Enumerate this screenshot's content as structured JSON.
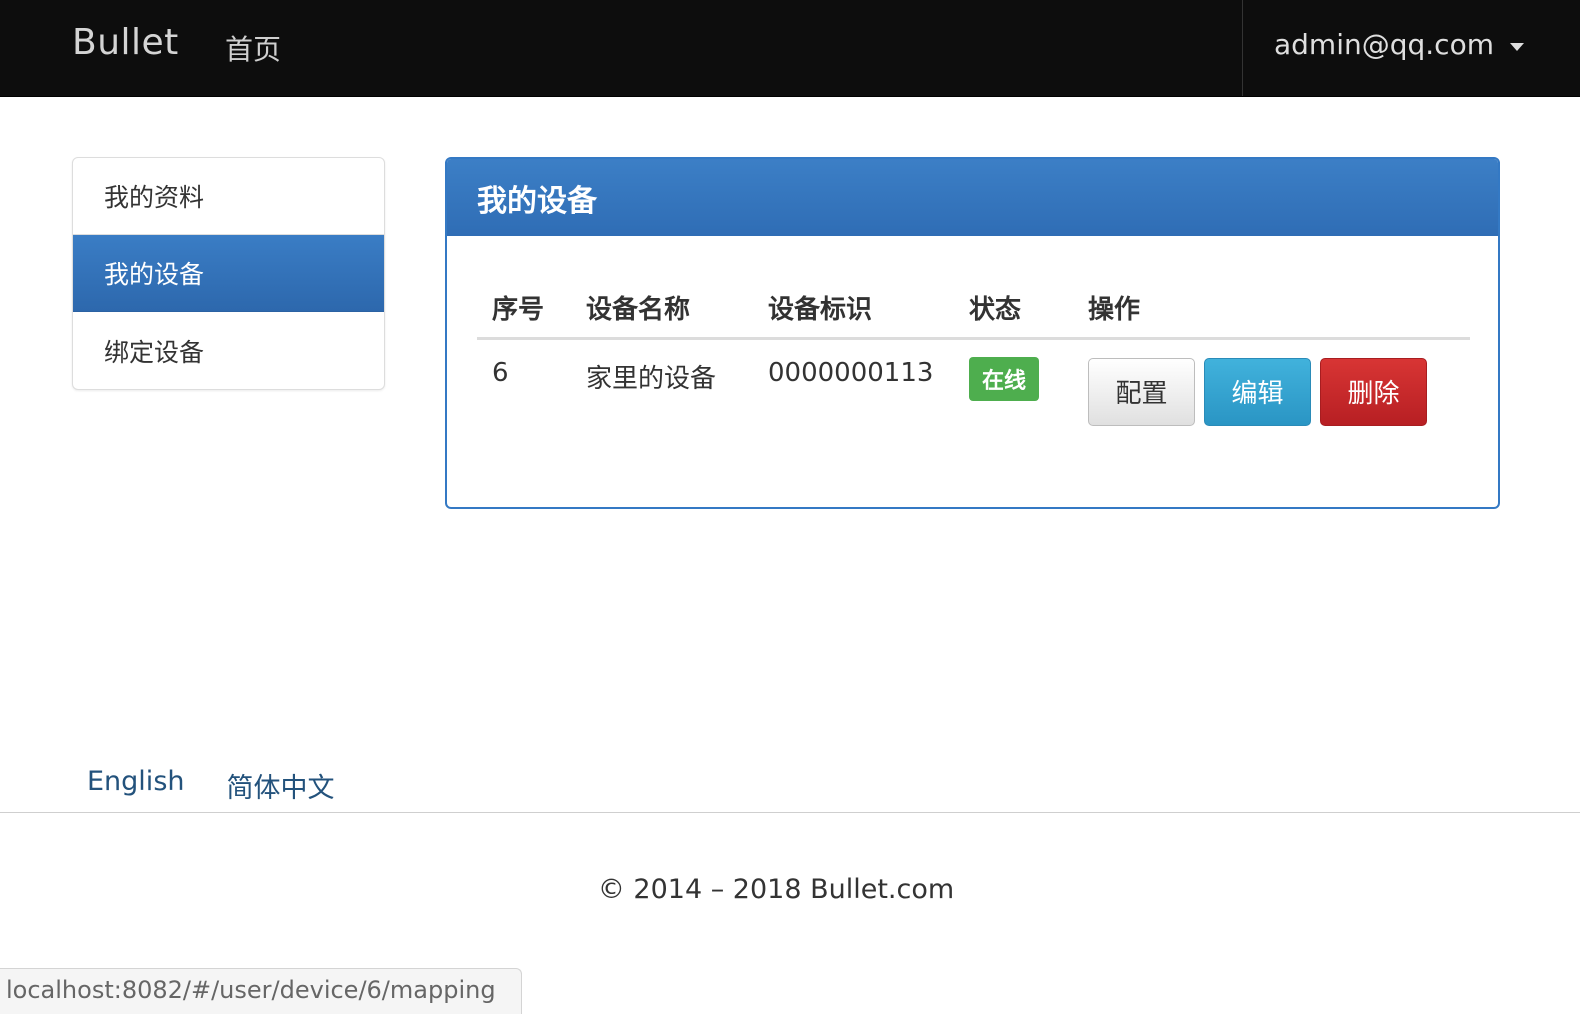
{
  "navbar": {
    "brand": "Bullet",
    "home": "首页",
    "user": "admin@qq.com"
  },
  "sidebar": {
    "items": [
      {
        "label": "我的资料",
        "active": false
      },
      {
        "label": "我的设备",
        "active": true
      },
      {
        "label": "绑定设备",
        "active": false
      }
    ]
  },
  "panel": {
    "title": "我的设备",
    "columns": [
      "序号",
      "设备名称",
      "设备标识",
      "状态",
      "操作"
    ],
    "rows": [
      {
        "no": "6",
        "name": "家里的设备",
        "identifier": "0000000113",
        "status": "在线",
        "actions": {
          "config": "配置",
          "edit": "编辑",
          "delete": "删除"
        }
      }
    ]
  },
  "footer": {
    "languages": [
      "English",
      "简体中文"
    ],
    "copyright": "© 2014 – 2018 Bullet.com"
  },
  "status_bar": {
    "url": "localhost:8082/#/user/device/6/mapping"
  },
  "colors": {
    "navbar_bg": "#0d0d0d",
    "primary": "#3479c4",
    "success": "#4eae4e",
    "info": "#2a95c4",
    "danger": "#c9302c",
    "link": "#23527c"
  }
}
